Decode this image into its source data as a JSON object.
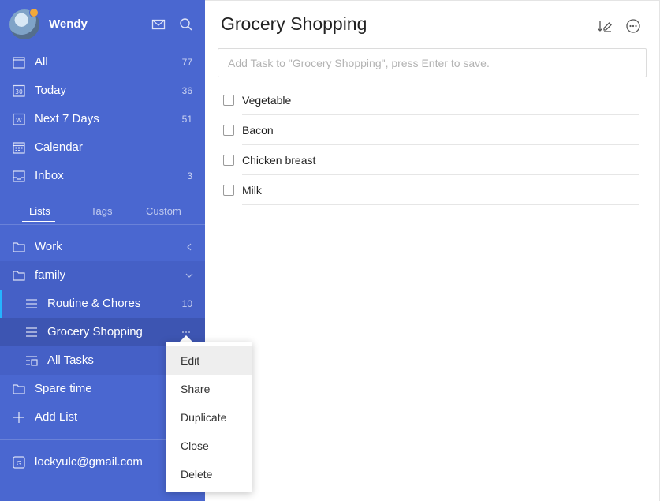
{
  "profile": {
    "username": "Wendy"
  },
  "smart_lists": [
    {
      "label": "All",
      "count": "77",
      "icon": "all-list-icon"
    },
    {
      "label": "Today",
      "count": "36",
      "icon": "calendar-today-icon"
    },
    {
      "label": "Next 7 Days",
      "count": "51",
      "icon": "next-week-icon"
    },
    {
      "label": "Calendar",
      "count": "",
      "icon": "calendar-icon"
    },
    {
      "label": "Inbox",
      "count": "3",
      "icon": "inbox-icon"
    }
  ],
  "tabs": [
    "Lists",
    "Tags",
    "Custom"
  ],
  "folders": [
    {
      "label": "Work"
    },
    {
      "label": "family"
    }
  ],
  "family_lists": [
    {
      "label": "Routine & Chores",
      "count": "10"
    },
    {
      "label": "Grocery Shopping",
      "count": ""
    },
    {
      "label": "All Tasks",
      "count": ""
    }
  ],
  "spare_time": {
    "label": "Spare time"
  },
  "add_list": {
    "label": "Add List"
  },
  "account": {
    "email": "lockyulc@gmail.com"
  },
  "context_menu": [
    "Edit",
    "Share",
    "Duplicate",
    "Close",
    "Delete"
  ],
  "main": {
    "title": "Grocery Shopping",
    "input_placeholder": "Add Task to \"Grocery Shopping\", press Enter to save.",
    "tasks": [
      "Vegetable",
      "Bacon",
      "Chicken breast",
      "Milk"
    ]
  },
  "colors": {
    "sidebar": "#4a67d0",
    "accent": "#24b4ff"
  }
}
